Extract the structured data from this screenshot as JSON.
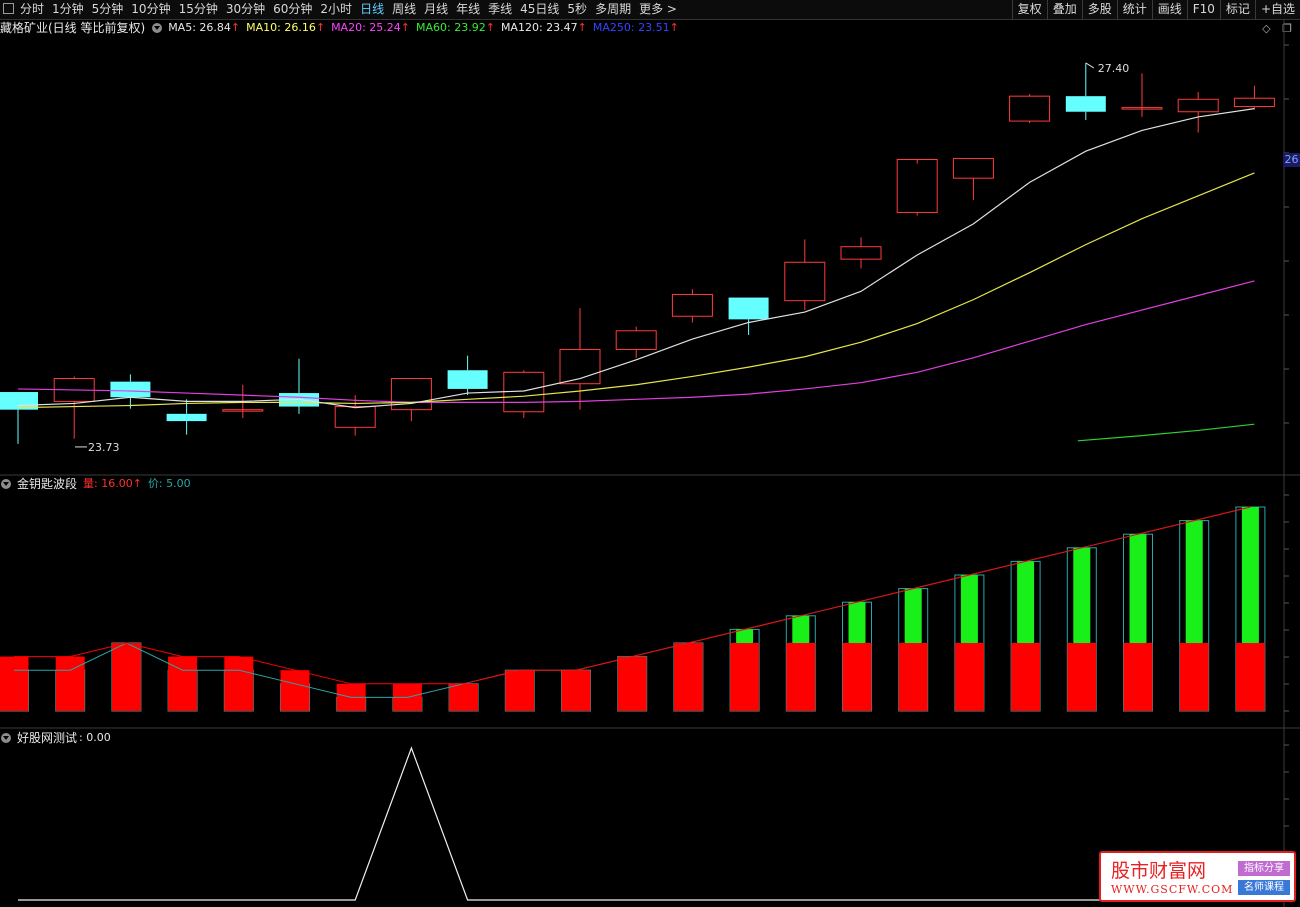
{
  "toolbar": {
    "periods": [
      "分时",
      "1分钟",
      "5分钟",
      "10分钟",
      "15分钟",
      "30分钟",
      "60分钟",
      "2小时",
      "日线",
      "周线",
      "月线",
      "年线",
      "季线",
      "45日线",
      "5秒",
      "多周期",
      "更多 >"
    ],
    "active_period": "日线",
    "right_buttons": [
      "复权",
      "叠加",
      "多股",
      "统计",
      "画线",
      "F10",
      "标记",
      "+自选"
    ]
  },
  "main_panel": {
    "title": "藏格矿业(日线 等比前复权)",
    "ma_items": [
      {
        "label": "MA5: 26.84",
        "arrow": "↑",
        "color": "#e8e8e8",
        "arrow_color": "#ff3030"
      },
      {
        "label": "MA10: 26.16",
        "arrow": "↑",
        "color": "#ffff66",
        "arrow_color": "#ff3030"
      },
      {
        "label": "MA20: 25.24",
        "arrow": "↑",
        "color": "#ff44ff",
        "arrow_color": "#ff3030"
      },
      {
        "label": "MA60: 23.92",
        "arrow": "↑",
        "color": "#33ee33",
        "arrow_color": "#ff3030"
      },
      {
        "label": "MA120: 23.47",
        "arrow": "↑",
        "color": "#e8e8e8",
        "arrow_color": "#ff3030"
      },
      {
        "label": "MA250: 23.51",
        "arrow": "↑",
        "color": "#3344ff",
        "arrow_color": "#ff3030"
      }
    ],
    "high_label": "27.40",
    "low_label": "23.73",
    "price_tag": "26",
    "side_icons": [
      "diamond-icon",
      "restore-window-icon"
    ],
    "colors": {
      "up": "#ff3b3b",
      "down": "#66ffff",
      "ma5": "#e0e0e0",
      "ma10": "#e6e64a",
      "ma20": "#e040e0",
      "ma60": "#30d030"
    },
    "candles": [
      {
        "o": 24.23,
        "h": 24.23,
        "l": 23.73,
        "c": 24.06
      },
      {
        "o": 24.14,
        "h": 24.38,
        "l": 23.78,
        "c": 24.36
      },
      {
        "o": 24.33,
        "h": 24.4,
        "l": 24.07,
        "c": 24.18
      },
      {
        "o": 24.02,
        "h": 24.16,
        "l": 23.82,
        "c": 23.95
      },
      {
        "o": 24.06,
        "h": 24.3,
        "l": 23.98,
        "c": 24.06
      },
      {
        "o": 24.22,
        "h": 24.55,
        "l": 24.02,
        "c": 24.09
      },
      {
        "o": 23.89,
        "h": 24.2,
        "l": 23.81,
        "c": 24.09
      },
      {
        "o": 24.06,
        "h": 24.36,
        "l": 23.95,
        "c": 24.36
      },
      {
        "o": 24.44,
        "h": 24.58,
        "l": 24.2,
        "c": 24.26
      },
      {
        "o": 24.04,
        "h": 24.44,
        "l": 23.98,
        "c": 24.42
      },
      {
        "o": 24.31,
        "h": 25.04,
        "l": 24.06,
        "c": 24.64
      },
      {
        "o": 24.64,
        "h": 24.86,
        "l": 24.56,
        "c": 24.82
      },
      {
        "o": 24.96,
        "h": 25.22,
        "l": 24.9,
        "c": 25.17
      },
      {
        "o": 25.14,
        "h": 25.14,
        "l": 24.78,
        "c": 24.93
      },
      {
        "o": 25.11,
        "h": 25.7,
        "l": 25.02,
        "c": 25.48
      },
      {
        "o": 25.51,
        "h": 25.72,
        "l": 25.42,
        "c": 25.63
      },
      {
        "o": 25.96,
        "h": 26.43,
        "l": 25.93,
        "c": 26.47
      },
      {
        "o": 26.29,
        "h": 26.48,
        "l": 26.08,
        "c": 26.48
      },
      {
        "o": 26.84,
        "h": 27.1,
        "l": 26.82,
        "c": 27.08
      },
      {
        "o": 27.08,
        "h": 27.4,
        "l": 26.85,
        "c": 26.93
      },
      {
        "o": 26.97,
        "h": 27.3,
        "l": 26.88,
        "c": 26.97
      },
      {
        "o": 26.93,
        "h": 27.12,
        "l": 26.73,
        "c": 27.05
      },
      {
        "o": 26.98,
        "h": 27.18,
        "l": 26.95,
        "c": 27.06
      }
    ],
    "ma5": [
      24.1,
      24.12,
      24.18,
      24.14,
      24.14,
      24.16,
      24.08,
      24.12,
      24.22,
      24.24,
      24.36,
      24.54,
      24.74,
      24.9,
      25.0,
      25.2,
      25.55,
      25.85,
      26.25,
      26.55,
      26.75,
      26.88,
      26.96
    ],
    "ma10": [
      24.08,
      24.09,
      24.1,
      24.12,
      24.13,
      24.13,
      24.12,
      24.13,
      24.16,
      24.19,
      24.24,
      24.3,
      24.38,
      24.47,
      24.57,
      24.71,
      24.89,
      25.12,
      25.38,
      25.65,
      25.9,
      26.12,
      26.34
    ],
    "ma20": [
      24.26,
      24.25,
      24.24,
      24.22,
      24.2,
      24.18,
      24.15,
      24.13,
      24.13,
      24.13,
      24.14,
      24.16,
      24.18,
      24.21,
      24.26,
      24.32,
      24.42,
      24.56,
      24.72,
      24.88,
      25.02,
      25.16,
      25.3
    ],
    "ma60": [
      null,
      null,
      null,
      null,
      null,
      null,
      null,
      null,
      null,
      null,
      null,
      null,
      null,
      null,
      null,
      null,
      null,
      null,
      null,
      23.76,
      23.81,
      23.86,
      23.92
    ],
    "ma_visible_from": {
      "ma5": 0,
      "ma10": 0,
      "ma20": 0,
      "ma60": 19
    }
  },
  "indicator1": {
    "name": "金钥匙波段",
    "items": [
      {
        "label": "量: 16.00",
        "arrow": "↑",
        "color": "#ff3030"
      },
      {
        "label": "价: 5.00",
        "arrow": "",
        "color": "#2aa6a6"
      }
    ],
    "outline_color": "#2aa6a6",
    "red_color": "#ff0000",
    "green_color": "#19f019",
    "vol": [
      3,
      3,
      5,
      3,
      3,
      2,
      1,
      1,
      2,
      3,
      3,
      4,
      5,
      6,
      7,
      8,
      9,
      10,
      11,
      12,
      13,
      14,
      15
    ],
    "price": [
      4,
      4,
      5,
      4,
      4,
      3,
      2,
      2,
      2,
      3,
      3,
      4,
      5,
      5,
      5,
      5,
      5,
      5,
      5,
      5,
      5,
      5,
      5
    ]
  },
  "indicator2": {
    "name": "好股网测试",
    "value_label": ": 0.00",
    "series": [
      0,
      0,
      0,
      0,
      0,
      0,
      0,
      1,
      0,
      0,
      0,
      0,
      0,
      0,
      0,
      0,
      0,
      0,
      0,
      0,
      0,
      0,
      0
    ]
  },
  "watermark": {
    "title": "股市财富网",
    "url": "WWW.GSCFW.COM",
    "tag1": "指标分享",
    "tag2": "名师课程"
  }
}
